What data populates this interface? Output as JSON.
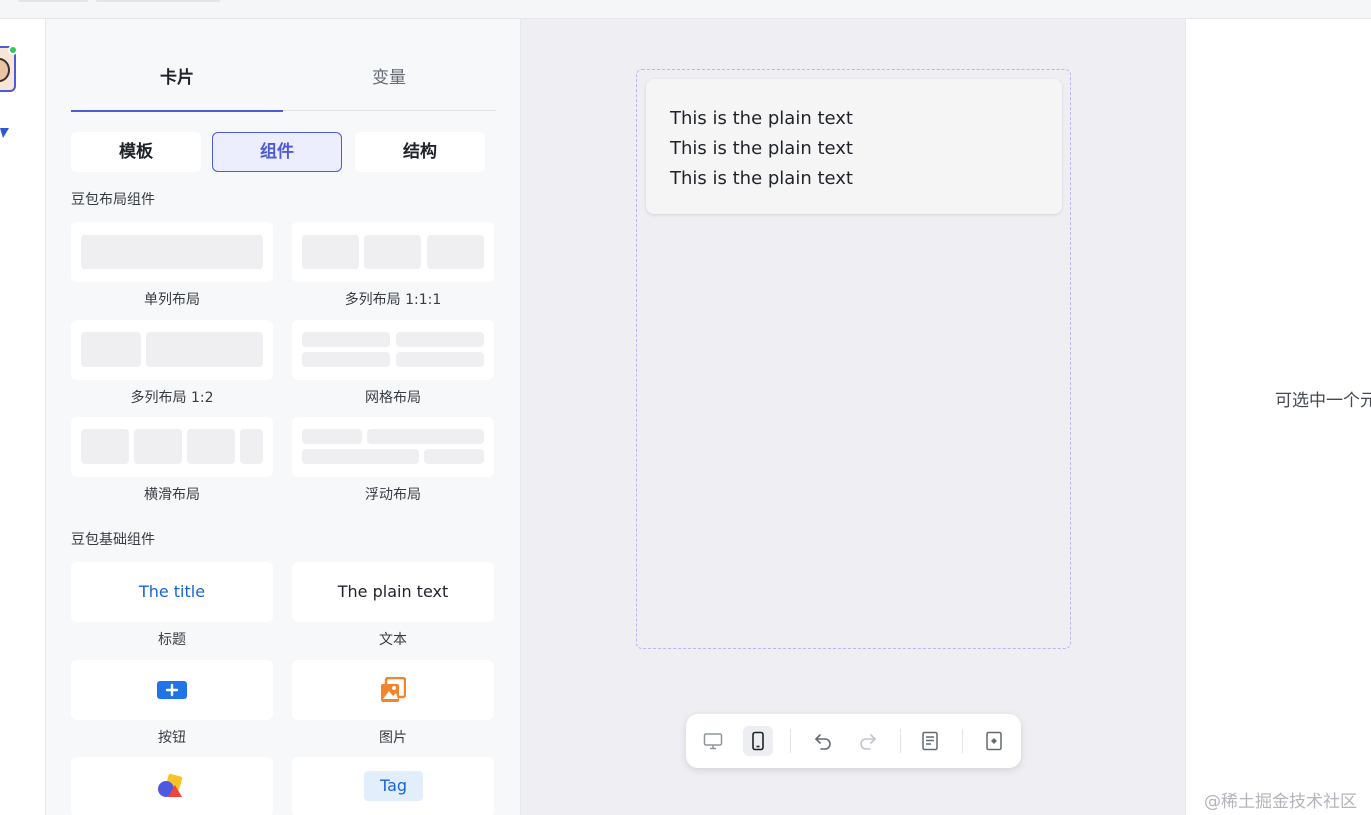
{
  "panel": {
    "tabs": [
      {
        "label": "卡片",
        "active": true
      },
      {
        "label": "变量",
        "active": false
      }
    ],
    "segments": [
      {
        "label": "模板",
        "active": false
      },
      {
        "label": "组件",
        "active": true
      },
      {
        "label": "结构",
        "active": false
      }
    ],
    "layout_section": {
      "title": "豆包布局组件",
      "items": [
        {
          "label": "单列布局"
        },
        {
          "label": "多列布局 1:1:1"
        },
        {
          "label": "多列布局 1:2"
        },
        {
          "label": "网格布局"
        },
        {
          "label": "横滑布局"
        },
        {
          "label": "浮动布局"
        }
      ]
    },
    "basic_section": {
      "title": "豆包基础组件",
      "items": [
        {
          "label": "标题",
          "preview": "The title"
        },
        {
          "label": "文本",
          "preview": "The plain text"
        },
        {
          "label": "按钮",
          "icon": "button-icon"
        },
        {
          "label": "图片",
          "icon": "image-icon"
        },
        {
          "label": "",
          "icon": "shapes-icon"
        },
        {
          "label": "",
          "preview": "Tag"
        }
      ]
    }
  },
  "canvas": {
    "text_lines": [
      "This is the plain text",
      "This is the plain text",
      "This is the plain text"
    ],
    "toolbar": [
      {
        "name": "desktop-view-button",
        "icon": "monitor-icon",
        "active": false
      },
      {
        "name": "mobile-view-button",
        "icon": "phone-icon",
        "active": true
      },
      {
        "name": "undo-button",
        "icon": "undo-icon",
        "active": false
      },
      {
        "name": "redo-button",
        "icon": "redo-icon",
        "active": false
      },
      {
        "name": "code-view-button",
        "icon": "document-icon",
        "active": false
      },
      {
        "name": "preview-button",
        "icon": "preview-icon",
        "active": false
      }
    ]
  },
  "props": {
    "hint": "可选中一个元"
  },
  "watermark": "@稀土掘金技术社区",
  "colors": {
    "accent": "#4f5bd5",
    "title_blue": "#1664d9",
    "online": "#34c759",
    "image_orange": "#f5832a"
  }
}
